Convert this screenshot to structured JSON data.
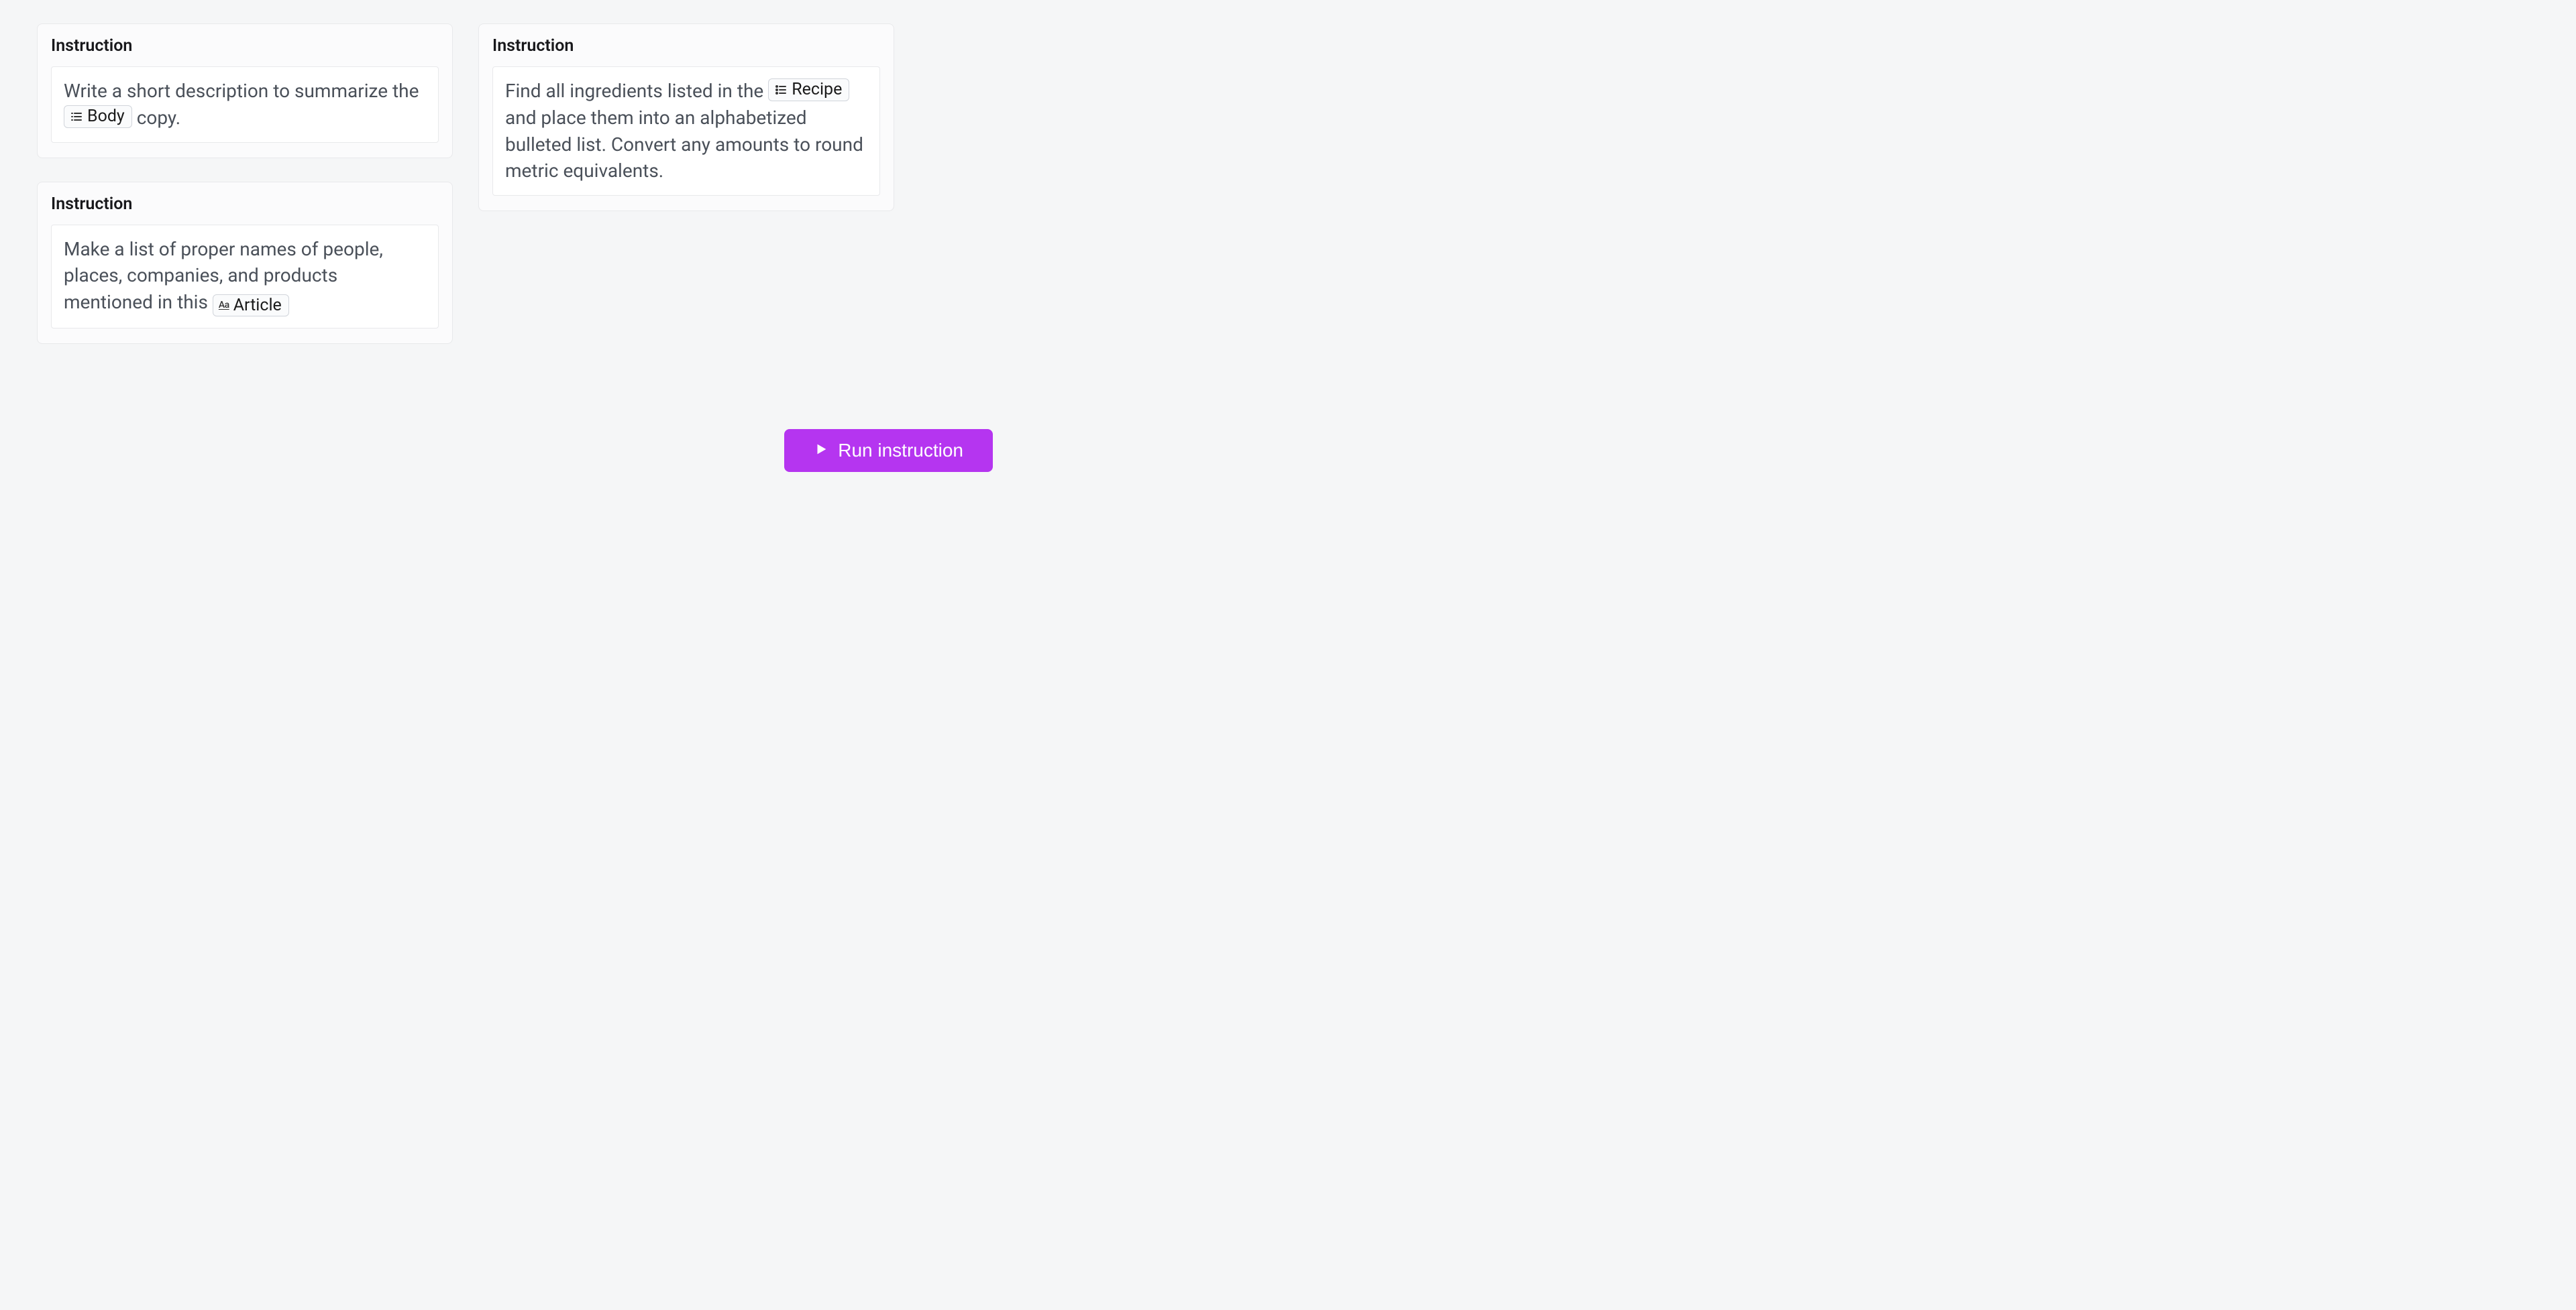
{
  "cards": [
    {
      "label": "Instruction",
      "segments": [
        {
          "type": "text",
          "value": "Write a short description to summarize the "
        },
        {
          "type": "tag",
          "icon": "lines",
          "label": "Body"
        },
        {
          "type": "text",
          "value": " copy."
        }
      ]
    },
    {
      "label": "Instruction",
      "segments": [
        {
          "type": "text",
          "value": "Make a list of proper names of people, places, companies, and products mentioned in this "
        },
        {
          "type": "tag",
          "icon": "aa",
          "label": "Article"
        }
      ]
    },
    {
      "label": "Instruction",
      "segments": [
        {
          "type": "text",
          "value": "Find all ingredients listed in the "
        },
        {
          "type": "tag",
          "icon": "list",
          "label": "Recipe"
        },
        {
          "type": "text",
          "value": " and place them into an alphabetized bulleted list. Convert any amounts to round metric equivalents."
        }
      ]
    }
  ],
  "run_button": {
    "label": "Run instruction"
  }
}
